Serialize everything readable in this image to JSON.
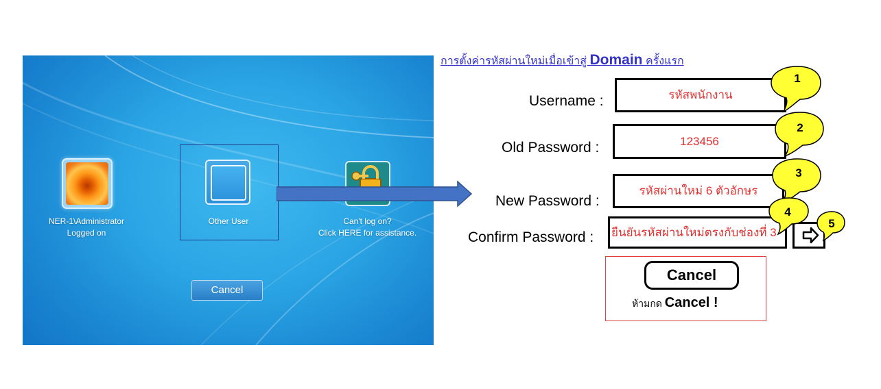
{
  "login": {
    "admin_tile": {
      "name": "NER-1\\Administrator",
      "status": "Logged on",
      "icon": "user-flower-icon"
    },
    "other_tile": {
      "label": "Other User",
      "icon": "blank-user-icon"
    },
    "help_tile": {
      "line1": "Can't log on?",
      "line2": "Click HERE for assistance.",
      "icon": "key-lock-icon"
    },
    "cancel_label": "Cancel"
  },
  "instructions": {
    "link_prefix": "การตั้งค่ารหัสผ่านใหม่เมื่อเข้าสู่ ",
    "link_domain": "Domain",
    "link_suffix": " ครั้งแรก",
    "fields": [
      {
        "label": "Username :",
        "value": "รหัสพนักงาน",
        "step": "1"
      },
      {
        "label": "Old Password :",
        "value": "123456",
        "step": "2"
      },
      {
        "label": "New Password :",
        "value": "รหัสผ่านใหม่ 6 ตัวอักษร",
        "step": "3"
      },
      {
        "label": "Confirm Password :",
        "value": "ยืนยันรหัสผ่านใหม่ตรงกับช่องที่ 3",
        "step": "4"
      }
    ],
    "go_step": "5",
    "go_icon": "arrow-right-icon",
    "cancel_label": "Cancel",
    "warning_prefix": "ห้ามกด ",
    "warning_bold": "Cancel !"
  },
  "colors": {
    "link": "#3333cc",
    "field_text": "#e03030",
    "callout": "#ffff33",
    "arrow": "#4472c4"
  }
}
